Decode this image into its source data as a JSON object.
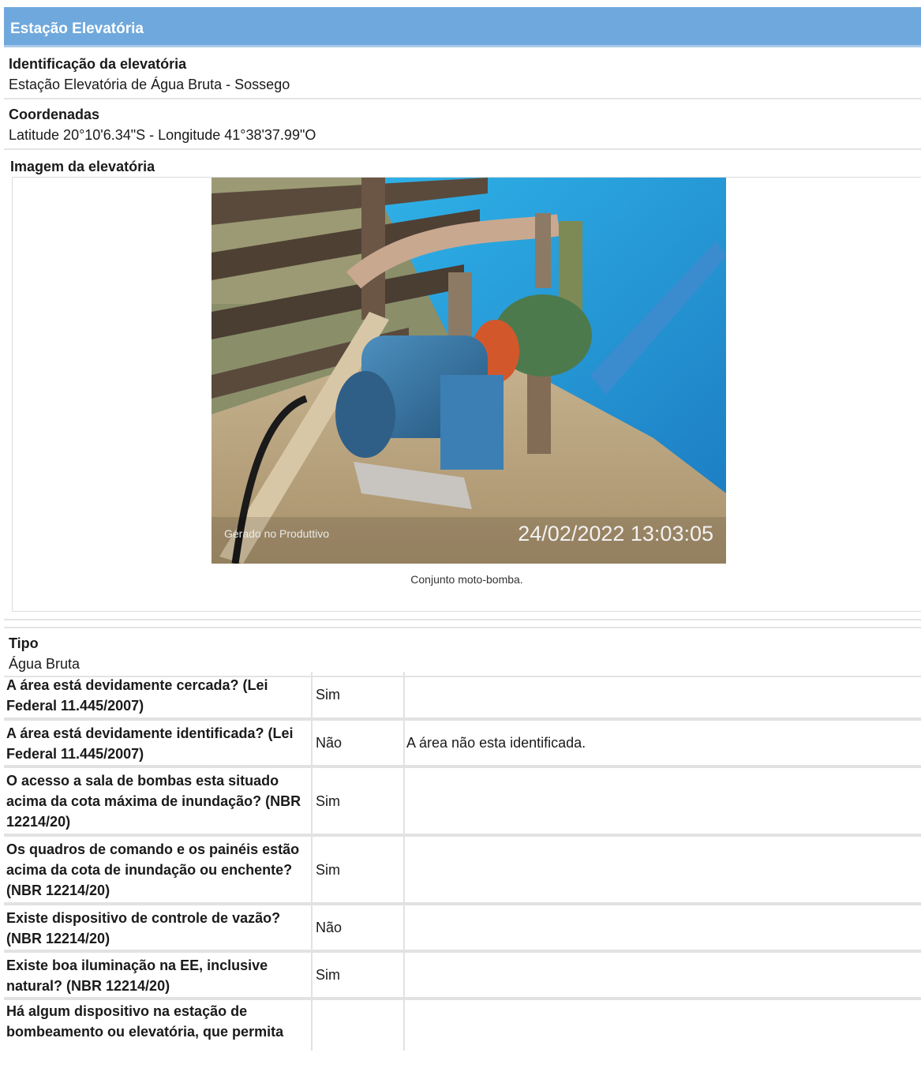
{
  "section": {
    "title": "Estação Elevatória"
  },
  "identificacao": {
    "label": "Identificação da elevatória",
    "value": "Estação Elevatória de Água Bruta - Sossego"
  },
  "coordenadas": {
    "label": "Coordenadas",
    "value": "Latitude 20°10'6.34\"S - Longitude 41°38'37.99\"O"
  },
  "imagem": {
    "label": "Imagem da elevatória",
    "watermark": "Gerado no Produttivo",
    "timestamp": "24/02/2022 13:03:05",
    "caption": "Conjunto moto-bomba."
  },
  "tipo": {
    "label": "Tipo",
    "value": "Água Bruta"
  },
  "questions": [
    {
      "question": "A área está devidamente cercada? (Lei Federal 11.445/2007)",
      "answer": "Sim",
      "obs": ""
    },
    {
      "question": "A área está devidamente identificada? (Lei Federal 11.445/2007)",
      "answer": "Não",
      "obs": "A área não esta identificada."
    },
    {
      "question": "O acesso a sala de bombas esta situado acima da cota máxima de inundação? (NBR 12214/20)",
      "answer": "Sim",
      "obs": ""
    },
    {
      "question": "Os quadros de comando e os painéis estão acima da cota de inundação ou enchente? (NBR 12214/20)",
      "answer": "Sim",
      "obs": ""
    },
    {
      "question": "Existe dispositivo de controle de vazão? (NBR 12214/20)",
      "answer": "Não",
      "obs": ""
    },
    {
      "question": "Existe boa iluminação na EE, inclusive natural? (NBR 12214/20)",
      "answer": "Sim",
      "obs": ""
    },
    {
      "question": "Há algum dispositivo na estação de bombeamento ou elevatória, que permita",
      "answer": "",
      "obs": ""
    }
  ]
}
